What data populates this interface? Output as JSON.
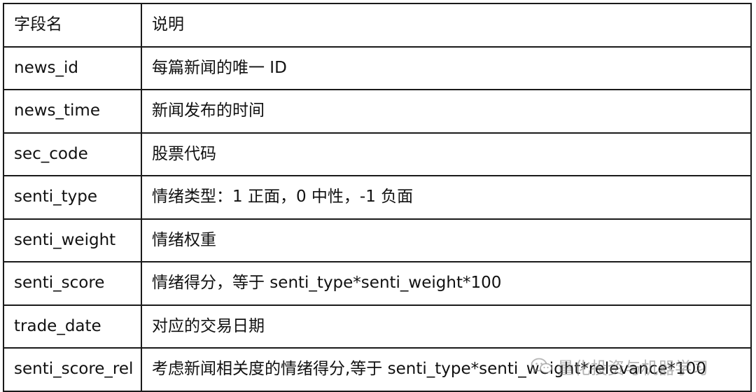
{
  "table": {
    "header": {
      "field": "字段名",
      "desc": "说明"
    },
    "rows": [
      {
        "field": "news_id",
        "desc": "每篇新闻的唯一 ID"
      },
      {
        "field": "news_time",
        "desc": "新闻发布的时间"
      },
      {
        "field": "sec_code",
        "desc": "股票代码"
      },
      {
        "field": "senti_type",
        "desc": "情绪类型：1 正面，0 中性，-1 负面"
      },
      {
        "field": "senti_weight",
        "desc": "情绪权重"
      },
      {
        "field": "senti_score",
        "desc": "情绪得分，等于 senti_type*senti_weight*100"
      },
      {
        "field": "trade_date",
        "desc": "对应的交易日期"
      },
      {
        "field": "senti_score_rel",
        "desc": "考虑新闻相关度的情绪得分,等于 senti_type*senti_weight*relevance*100"
      }
    ]
  },
  "watermark": {
    "text": "量化投资与机器学习",
    "icon": "wechat-icon",
    "color": "#8a8a8a"
  }
}
